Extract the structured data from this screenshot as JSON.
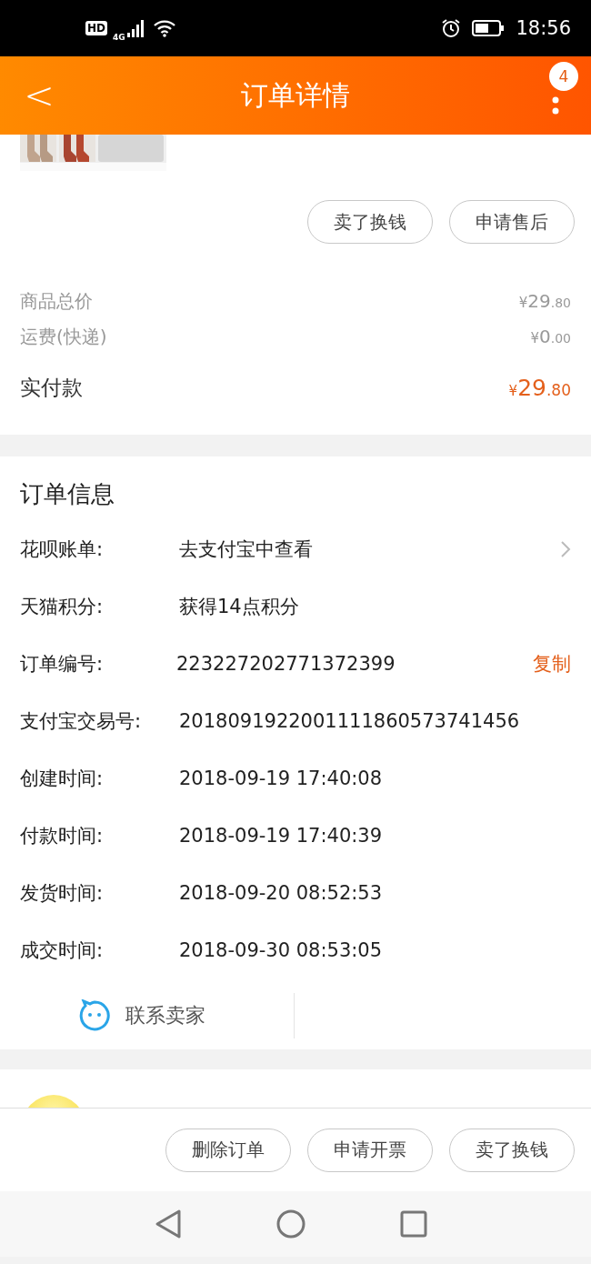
{
  "status_bar": {
    "hd": "HD",
    "network": "4G",
    "time": "18:56"
  },
  "header": {
    "back": "<",
    "title": "订单详情",
    "badge": "4"
  },
  "product": {
    "kind": "picture"
  },
  "item_actions": [
    "卖了换钱",
    "申请售后"
  ],
  "summary": [
    {
      "kind": "minor",
      "label": "商品总价",
      "symbol": "¥",
      "whole": "29",
      "fraction": ".80"
    },
    {
      "kind": "minor",
      "label": "运费(快递)",
      "symbol": "¥",
      "whole": "0",
      "fraction": ".00"
    },
    {
      "kind": "total",
      "label": "实付款",
      "symbol": "¥",
      "whole": "29",
      "fraction": ".80"
    }
  ],
  "order_info": {
    "title": "订单信息",
    "rows": [
      {
        "kind": "link",
        "label": "花呗账单:",
        "value": "去支付宝中查看"
      },
      {
        "kind": "plain",
        "label": "天猫积分:",
        "value": "获得14点积分"
      },
      {
        "kind": "copy",
        "label": "订单编号:",
        "value": "223227202771372399",
        "action": "复制"
      },
      {
        "kind": "plain",
        "label": "支付宝交易号:",
        "value": "2018091922001111860573741456"
      },
      {
        "kind": "plain",
        "label": "创建时间:",
        "value": "2018-09-19 17:40:08"
      },
      {
        "kind": "plain",
        "label": "付款时间:",
        "value": "2018-09-19 17:40:39"
      },
      {
        "kind": "plain",
        "label": "发货时间:",
        "value": "2018-09-20 08:52:53"
      },
      {
        "kind": "plain",
        "label": "成交时间:",
        "value": "2018-09-30 08:53:05"
      }
    ],
    "contact": "联系卖家"
  },
  "bottom_actions": [
    "删除订单",
    "申请开票",
    "卖了换钱"
  ]
}
